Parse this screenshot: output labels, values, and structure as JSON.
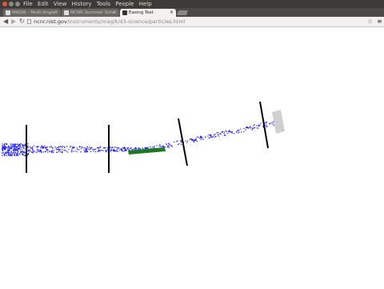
{
  "menubar": {
    "window_buttons": [
      {
        "name": "close-window-button",
        "color": "#e0553d"
      },
      {
        "name": "minimize-window-button",
        "color": "#8d8b84"
      },
      {
        "name": "maximize-window-button",
        "color": "#8d8b84"
      }
    ],
    "menus": [
      "File",
      "Edit",
      "View",
      "History",
      "Tools",
      "People",
      "Help"
    ]
  },
  "tabs": [
    {
      "title": "MAGIK - Multi-Angle",
      "active": false
    },
    {
      "title": "NCNR Summer Scho",
      "active": false
    },
    {
      "title": "Easing Test",
      "active": true
    }
  ],
  "toolbar": {
    "url_host": "ncnr.nist.gov",
    "url_path": "/instruments/magik/d3-science/particles.html"
  },
  "scene": {
    "beam_color": "#1a1aff",
    "slit_color": "#000000",
    "sample_color": "#1f7a1f",
    "detector_color": "#d0d0d0"
  }
}
